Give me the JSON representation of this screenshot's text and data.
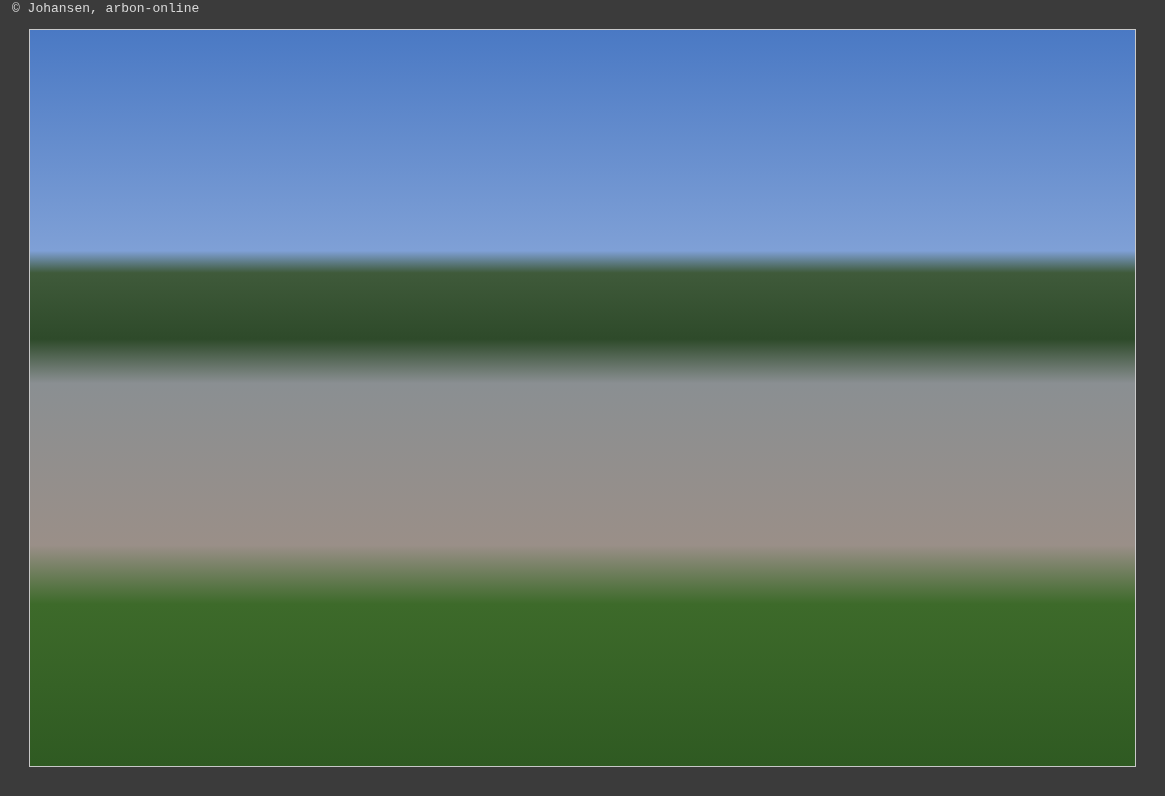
{
  "credit": "© Johansen, arbon-online"
}
